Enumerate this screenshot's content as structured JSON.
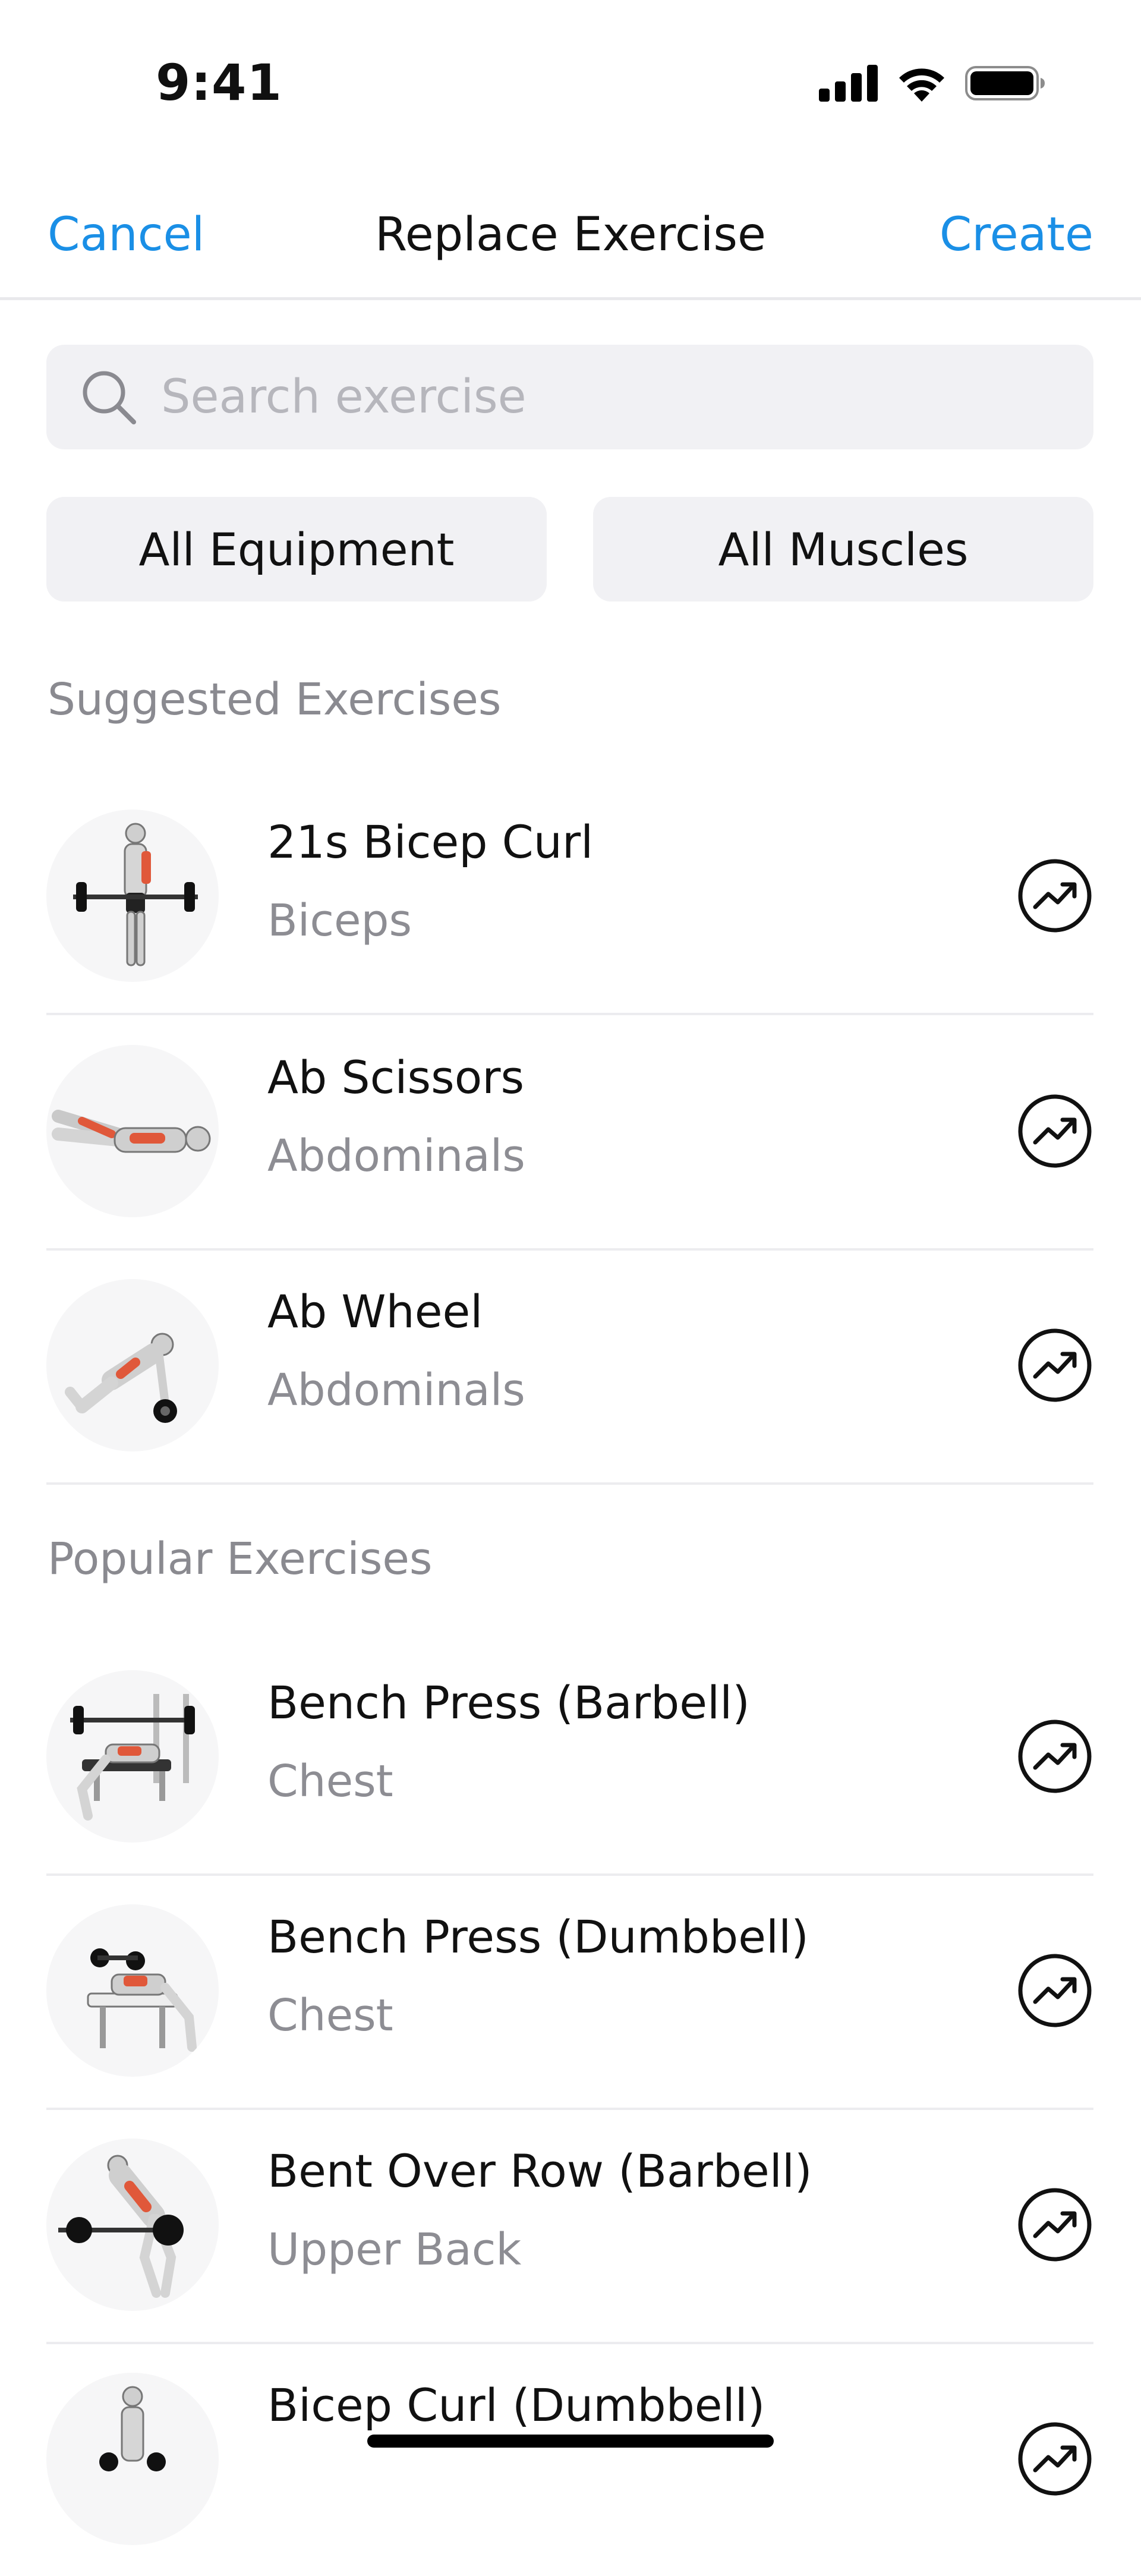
{
  "status_bar": {
    "time": "9:41"
  },
  "nav": {
    "cancel_label": "Cancel",
    "title": "Replace Exercise",
    "create_label": "Create"
  },
  "search": {
    "placeholder": "Search exercise",
    "value": ""
  },
  "filters": {
    "equipment_label": "All Equipment",
    "muscles_label": "All Muscles"
  },
  "sections": [
    {
      "title": "Suggested Exercises",
      "items": [
        {
          "name": "21s Bicep Curl",
          "muscle": "Biceps",
          "thumbnail_icon": "barbell-curl-figure-icon"
        },
        {
          "name": "Ab Scissors",
          "muscle": "Abdominals",
          "thumbnail_icon": "lying-scissors-figure-icon"
        },
        {
          "name": "Ab Wheel",
          "muscle": "Abdominals",
          "thumbnail_icon": "ab-wheel-figure-icon"
        }
      ]
    },
    {
      "title": "Popular Exercises",
      "items": [
        {
          "name": "Bench Press (Barbell)",
          "muscle": "Chest",
          "thumbnail_icon": "barbell-bench-figure-icon"
        },
        {
          "name": "Bench Press (Dumbbell)",
          "muscle": "Chest",
          "thumbnail_icon": "dumbbell-bench-figure-icon"
        },
        {
          "name": "Bent Over Row (Barbell)",
          "muscle": "Upper Back",
          "thumbnail_icon": "barbell-row-figure-icon"
        },
        {
          "name": "Bicep Curl (Dumbbell)",
          "muscle": "",
          "thumbnail_icon": "dumbbell-curl-figure-icon"
        }
      ]
    }
  ],
  "colors": {
    "accent": "#1a8fe6",
    "secondary_text": "#8d8d93",
    "field_bg": "#f1f1f4",
    "muscle_highlight": "#e0583a"
  }
}
